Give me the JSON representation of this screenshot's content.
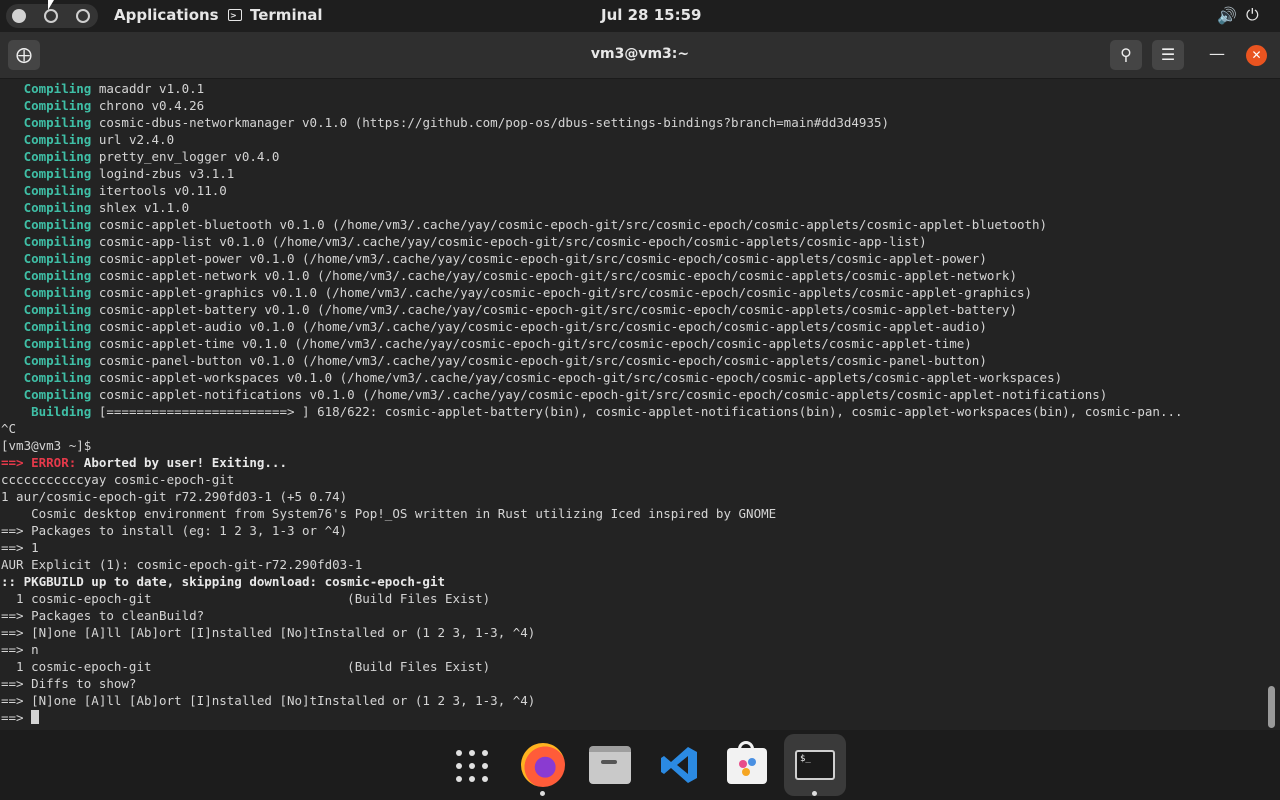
{
  "topbar": {
    "applications": "Applications",
    "app_name": "Terminal",
    "clock": "Jul 28  15:59",
    "volume_icon": "volume-icon",
    "power_icon": "power-icon"
  },
  "window": {
    "title": "vm3@vm3:~",
    "buttons": [
      "new-tab-icon",
      "search-icon",
      "menu-icon",
      "minimize-icon",
      "close-icon"
    ]
  },
  "terminal": {
    "lines": [
      {
        "prefix": "   Compiling",
        "text": " macaddr v1.0.1",
        "style": "g"
      },
      {
        "prefix": "   Compiling",
        "text": " chrono v0.4.26",
        "style": "g"
      },
      {
        "prefix": "   Compiling",
        "text": " cosmic-dbus-networkmanager v0.1.0 (https://github.com/pop-os/dbus-settings-bindings?branch=main#dd3d4935)",
        "style": "g"
      },
      {
        "prefix": "   Compiling",
        "text": " url v2.4.0",
        "style": "g"
      },
      {
        "prefix": "   Compiling",
        "text": " pretty_env_logger v0.4.0",
        "style": "g"
      },
      {
        "prefix": "   Compiling",
        "text": " logind-zbus v3.1.1",
        "style": "g"
      },
      {
        "prefix": "   Compiling",
        "text": " itertools v0.11.0",
        "style": "g"
      },
      {
        "prefix": "   Compiling",
        "text": " shlex v1.1.0",
        "style": "g"
      },
      {
        "prefix": "   Compiling",
        "text": " cosmic-applet-bluetooth v0.1.0 (/home/vm3/.cache/yay/cosmic-epoch-git/src/cosmic-epoch/cosmic-applets/cosmic-applet-bluetooth)",
        "style": "g"
      },
      {
        "prefix": "   Compiling",
        "text": " cosmic-app-list v0.1.0 (/home/vm3/.cache/yay/cosmic-epoch-git/src/cosmic-epoch/cosmic-applets/cosmic-app-list)",
        "style": "g"
      },
      {
        "prefix": "   Compiling",
        "text": " cosmic-applet-power v0.1.0 (/home/vm3/.cache/yay/cosmic-epoch-git/src/cosmic-epoch/cosmic-applets/cosmic-applet-power)",
        "style": "g"
      },
      {
        "prefix": "   Compiling",
        "text": " cosmic-applet-network v0.1.0 (/home/vm3/.cache/yay/cosmic-epoch-git/src/cosmic-epoch/cosmic-applets/cosmic-applet-network)",
        "style": "g"
      },
      {
        "prefix": "   Compiling",
        "text": " cosmic-applet-graphics v0.1.0 (/home/vm3/.cache/yay/cosmic-epoch-git/src/cosmic-epoch/cosmic-applets/cosmic-applet-graphics)",
        "style": "g"
      },
      {
        "prefix": "   Compiling",
        "text": " cosmic-applet-battery v0.1.0 (/home/vm3/.cache/yay/cosmic-epoch-git/src/cosmic-epoch/cosmic-applets/cosmic-applet-battery)",
        "style": "g"
      },
      {
        "prefix": "   Compiling",
        "text": " cosmic-applet-audio v0.1.0 (/home/vm3/.cache/yay/cosmic-epoch-git/src/cosmic-epoch/cosmic-applets/cosmic-applet-audio)",
        "style": "g"
      },
      {
        "prefix": "   Compiling",
        "text": " cosmic-applet-time v0.1.0 (/home/vm3/.cache/yay/cosmic-epoch-git/src/cosmic-epoch/cosmic-applets/cosmic-applet-time)",
        "style": "g"
      },
      {
        "prefix": "   Compiling",
        "text": " cosmic-panel-button v0.1.0 (/home/vm3/.cache/yay/cosmic-epoch-git/src/cosmic-epoch/cosmic-applets/cosmic-panel-button)",
        "style": "g"
      },
      {
        "prefix": "   Compiling",
        "text": " cosmic-applet-workspaces v0.1.0 (/home/vm3/.cache/yay/cosmic-epoch-git/src/cosmic-epoch/cosmic-applets/cosmic-applet-workspaces)",
        "style": "g"
      },
      {
        "prefix": "   Compiling",
        "text": " cosmic-applet-notifications v0.1.0 (/home/vm3/.cache/yay/cosmic-epoch-git/src/cosmic-epoch/cosmic-applets/cosmic-applet-notifications)",
        "style": "g"
      },
      {
        "prefix": "    Building",
        "text": " [========================> ] 618/622: cosmic-applet-battery(bin), cosmic-applet-notifications(bin), cosmic-applet-workspaces(bin), cosmic-pan...",
        "style": "g"
      },
      {
        "prefix": "",
        "text": "^C",
        "style": ""
      },
      {
        "prefix": "",
        "text": "[vm3@vm3 ~]$",
        "style": ""
      },
      {
        "prefix": "==> ERROR:",
        "text": " Aborted by user! Exiting...",
        "style": "err"
      },
      {
        "prefix": "",
        "text": "cccccccccccyay cosmic-epoch-git",
        "style": ""
      },
      {
        "prefix": "",
        "text": "1 aur/cosmic-epoch-git r72.290fd03-1 (+5 0.74)",
        "style": ""
      },
      {
        "prefix": "",
        "text": "    Cosmic desktop environment from System76's Pop!_OS written in Rust utilizing Iced inspired by GNOME",
        "style": ""
      },
      {
        "prefix": "",
        "text": "==> Packages to install (eg: 1 2 3, 1-3 or ^4)",
        "style": ""
      },
      {
        "prefix": "",
        "text": "==> 1",
        "style": ""
      },
      {
        "prefix": "",
        "text": "AUR Explicit (1): cosmic-epoch-git-r72.290fd03-1",
        "style": ""
      },
      {
        "prefix": "",
        "text": ":: PKGBUILD up to date, skipping download: cosmic-epoch-git",
        "style": "bold"
      },
      {
        "prefix": "",
        "text": "  1 cosmic-epoch-git                          (Build Files Exist)",
        "style": ""
      },
      {
        "prefix": "",
        "text": "==> Packages to cleanBuild?",
        "style": ""
      },
      {
        "prefix": "",
        "text": "==> [N]one [A]ll [Ab]ort [I]nstalled [No]tInstalled or (1 2 3, 1-3, ^4)",
        "style": ""
      },
      {
        "prefix": "",
        "text": "==> n",
        "style": ""
      },
      {
        "prefix": "",
        "text": "  1 cosmic-epoch-git                          (Build Files Exist)",
        "style": ""
      },
      {
        "prefix": "",
        "text": "==> Diffs to show?",
        "style": ""
      },
      {
        "prefix": "",
        "text": "==> [N]one [A]ll [Ab]ort [I]nstalled [No]tInstalled or (1 2 3, 1-3, ^4)",
        "style": ""
      },
      {
        "prefix": "",
        "text": "==> ",
        "style": "prompt"
      }
    ]
  },
  "dock": {
    "items": [
      {
        "name": "app-grid-icon",
        "active": false
      },
      {
        "name": "firefox-icon",
        "active": false,
        "running": true
      },
      {
        "name": "files-icon",
        "active": false
      },
      {
        "name": "vscode-icon",
        "active": false
      },
      {
        "name": "app-store-icon",
        "active": false
      },
      {
        "name": "terminal-icon",
        "active": true,
        "running": true
      }
    ],
    "terminal_glyph": "$_"
  }
}
